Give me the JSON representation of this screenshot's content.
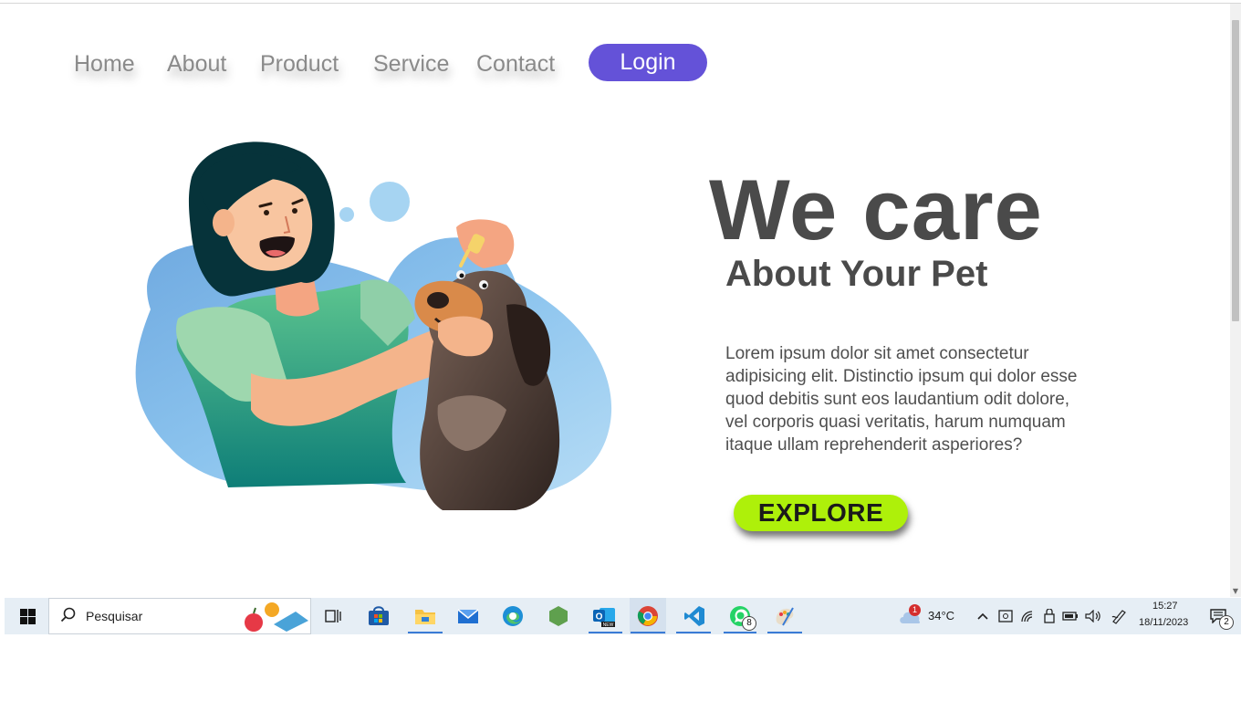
{
  "nav": {
    "items": [
      "Home",
      "About",
      "Product",
      "Service",
      "Contact"
    ],
    "login_label": "Login"
  },
  "hero": {
    "title": "We care",
    "subtitle": "About Your Pet",
    "body": "Lorem ipsum dolor sit amet consectetur adipisicing elit. Distinctio ipsum qui dolor esse quod debitis sunt eos laudantium odit dolore, vel corporis quasi veritatis, harum numquam itaque ullam reprehenderit asperiores?",
    "cta_label": "EXPLORE"
  },
  "colors": {
    "accent": "#6452d8",
    "cta": "#aef00a",
    "heading": "#4a4a4a",
    "nav_text": "#8a8a8a"
  },
  "taskbar": {
    "search_placeholder": "Pesquisar",
    "weather_temp": "34°C",
    "weather_badge": "1",
    "time": "15:27",
    "date": "18/11/2023",
    "whatsapp_badge": "8",
    "notifications_badge": "2",
    "apps": [
      "task-view",
      "microsoft-store",
      "file-explorer",
      "mail",
      "edge",
      "node",
      "outlook-new",
      "chrome",
      "vscode",
      "whatsapp",
      "paint"
    ]
  }
}
